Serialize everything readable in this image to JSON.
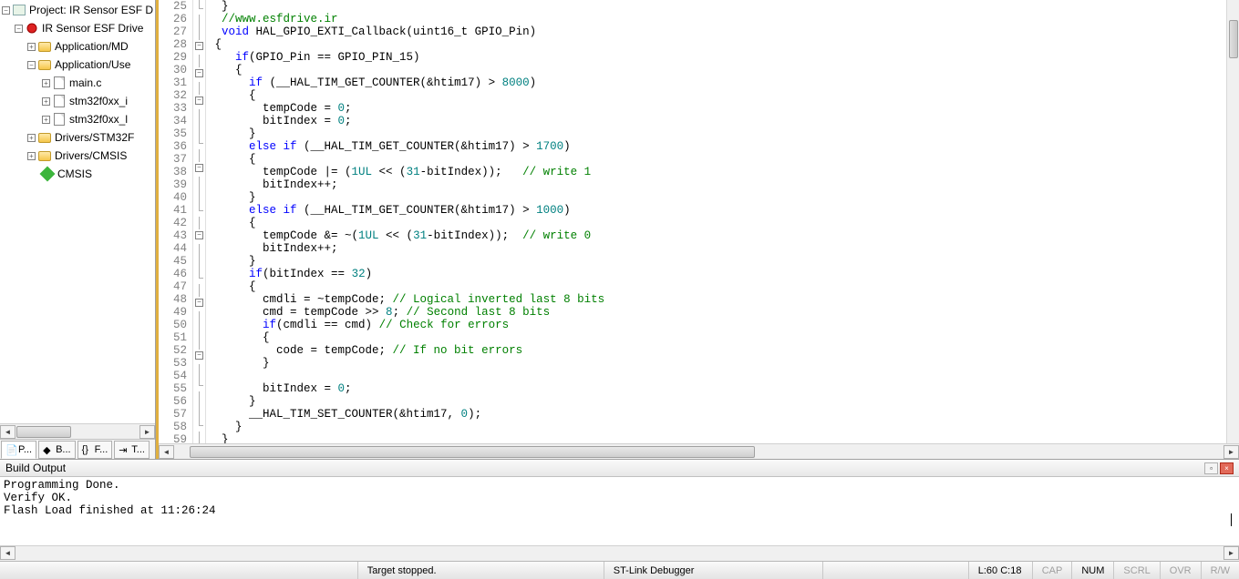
{
  "tree": {
    "project": "Project: IR Sensor ESF D",
    "target": "IR Sensor ESF Drive",
    "group_app_md": "Application/MD",
    "group_app_user": "Application/Use",
    "file_main": "main.c",
    "file_it": "stm32f0xx_i",
    "file_msp": "stm32f0xx_l",
    "group_drv_hal": "Drivers/STM32F",
    "group_drv_cmsis": "Drivers/CMSIS",
    "group_cmsis": "CMSIS"
  },
  "side_tabs": {
    "t0": "P...",
    "t1": "B...",
    "t2": "F...",
    "t3": "T..."
  },
  "lines": [
    {
      "n": 25,
      "fold": "end",
      "html": "  }"
    },
    {
      "n": 26,
      "fold": "line",
      "html": "  <span class='cm'>//www.esfdrive.ir</span>"
    },
    {
      "n": 27,
      "fold": "line",
      "html": "  <span class='kw'>void</span> HAL_GPIO_EXTI_Callback(uint16_t GPIO_Pin)"
    },
    {
      "n": 28,
      "fold": "open",
      "html": " {"
    },
    {
      "n": 29,
      "fold": "line",
      "html": "    <span class='kw'>if</span>(GPIO_Pin == GPIO_PIN_15)"
    },
    {
      "n": 30,
      "fold": "open",
      "html": "    {"
    },
    {
      "n": 31,
      "fold": "line",
      "html": "      <span class='kw'>if</span> (__HAL_TIM_GET_COUNTER(&amp;htim17) &gt; <span class='num'>8000</span>)"
    },
    {
      "n": 32,
      "fold": "open",
      "html": "      {"
    },
    {
      "n": 33,
      "fold": "line",
      "html": "        tempCode = <span class='num'>0</span>;"
    },
    {
      "n": 34,
      "fold": "line",
      "html": "        bitIndex = <span class='num'>0</span>;"
    },
    {
      "n": 35,
      "fold": "end",
      "html": "      }"
    },
    {
      "n": 36,
      "fold": "line",
      "html": "      <span class='kw'>else if</span> (__HAL_TIM_GET_COUNTER(&amp;htim17) &gt; <span class='num'>1700</span>)"
    },
    {
      "n": 37,
      "fold": "open",
      "html": "      {"
    },
    {
      "n": 38,
      "fold": "line",
      "html": "        tempCode |= (<span class='num'>1UL</span> &lt;&lt; (<span class='num'>31</span>-bitIndex));   <span class='cm'>// write 1</span>"
    },
    {
      "n": 39,
      "fold": "line",
      "html": "        bitIndex++;"
    },
    {
      "n": 40,
      "fold": "end",
      "html": "      }"
    },
    {
      "n": 41,
      "fold": "line",
      "html": "      <span class='kw'>else if</span> (__HAL_TIM_GET_COUNTER(&amp;htim17) &gt; <span class='num'>1000</span>)"
    },
    {
      "n": 42,
      "fold": "open",
      "html": "      {"
    },
    {
      "n": 43,
      "fold": "line",
      "html": "        tempCode &amp;= ~(<span class='num'>1UL</span> &lt;&lt; (<span class='num'>31</span>-bitIndex));  <span class='cm'>// write 0</span>"
    },
    {
      "n": 44,
      "fold": "line",
      "html": "        bitIndex++;"
    },
    {
      "n": 45,
      "fold": "end",
      "html": "      }"
    },
    {
      "n": 46,
      "fold": "line",
      "html": "      <span class='kw'>if</span>(bitIndex == <span class='num'>32</span>)"
    },
    {
      "n": 47,
      "fold": "open",
      "html": "      {"
    },
    {
      "n": 48,
      "fold": "line",
      "html": "        cmdli = ~tempCode; <span class='cm'>// Logical inverted last 8 bits</span>"
    },
    {
      "n": 49,
      "fold": "line",
      "html": "        cmd = tempCode &gt;&gt; <span class='num'>8</span>; <span class='cm'>// Second last 8 bits</span>"
    },
    {
      "n": 50,
      "fold": "line",
      "html": "        <span class='kw'>if</span>(cmdli == cmd) <span class='cm'>// Check for errors</span>"
    },
    {
      "n": 51,
      "fold": "open",
      "html": "        {"
    },
    {
      "n": 52,
      "fold": "line",
      "html": "          code = tempCode; <span class='cm'>// If no bit errors</span>"
    },
    {
      "n": 53,
      "fold": "end",
      "html": "        }"
    },
    {
      "n": 54,
      "fold": "line",
      "html": ""
    },
    {
      "n": 55,
      "fold": "line",
      "html": "        bitIndex = <span class='num'>0</span>;"
    },
    {
      "n": 56,
      "fold": "end",
      "html": "      }"
    },
    {
      "n": 57,
      "fold": "line",
      "html": "      __HAL_TIM_SET_COUNTER(&amp;htim17, <span class='num'>0</span>);"
    },
    {
      "n": 58,
      "fold": "end",
      "html": "    }"
    },
    {
      "n": 59,
      "fold": "line",
      "html": "  }"
    }
  ],
  "build": {
    "title": "Build Output",
    "l0": "Programming Done.",
    "l1": "Verify OK.",
    "l2": "Flash Load finished at 11:26:24"
  },
  "status": {
    "target": "Target stopped.",
    "debugger": "ST-Link Debugger",
    "pos": "L:60 C:18",
    "cap": "CAP",
    "num": "NUM",
    "scrl": "SCRL",
    "ovr": "OVR",
    "rw": "R/W"
  }
}
